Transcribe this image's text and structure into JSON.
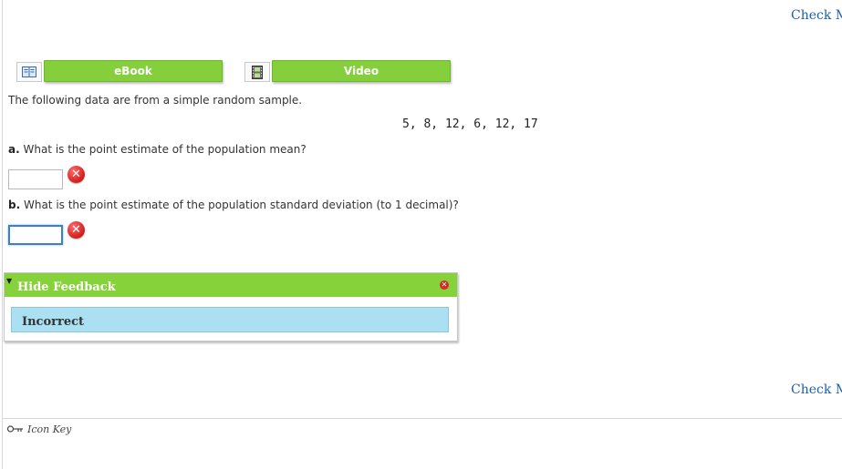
{
  "header": {
    "check_my_work": "Check My Work"
  },
  "resources": {
    "ebook": {
      "label": "eBook",
      "icon": "book-icon"
    },
    "video": {
      "label": "Video",
      "icon": "film-icon"
    }
  },
  "problem": {
    "intro": "The following data are from a simple random sample.",
    "data_values": "5, 8, 12, 6, 12, 17",
    "questions": [
      {
        "letter": "a.",
        "text": "What is the point estimate of the population mean?",
        "answer": "",
        "status": "incorrect"
      },
      {
        "letter": "b.",
        "text": "What is the point estimate of the population standard deviation (to 1 decimal)?",
        "answer": "",
        "status": "incorrect"
      }
    ]
  },
  "feedback": {
    "header": "Hide Feedback",
    "message": "Incorrect",
    "colors": {
      "header": "#86d23a",
      "body": "#abdff2"
    }
  },
  "footer": {
    "check_my_work": "Check My Work",
    "icon_key": "Icon Key"
  },
  "colors": {
    "accent_green": "#86cf3c",
    "link_blue": "#1a5fa8",
    "error_red": "#d31d1d"
  }
}
